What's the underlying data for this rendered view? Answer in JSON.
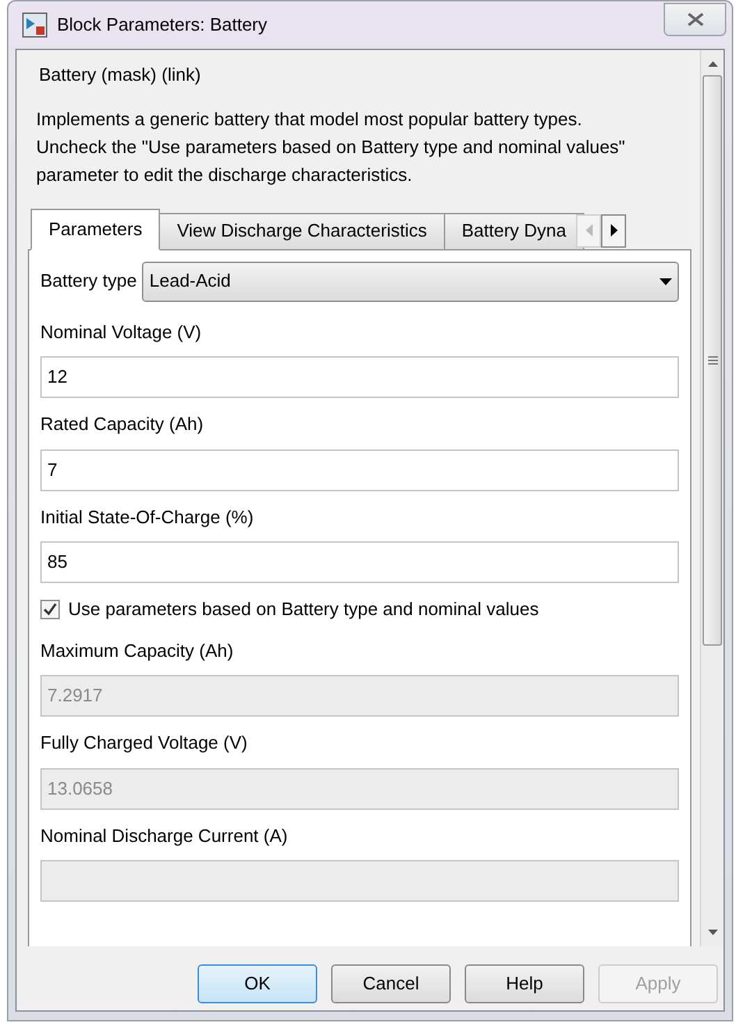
{
  "window": {
    "title": "Block Parameters: Battery"
  },
  "header": "Battery (mask) (link)",
  "description": "Implements a generic battery that model most popular battery types. Uncheck the \"Use parameters based on Battery type and nominal values\" parameter to edit the discharge characteristics.",
  "tabs": [
    {
      "label": "Parameters",
      "selected": true
    },
    {
      "label": "View Discharge Characteristics",
      "selected": false
    },
    {
      "label": "Battery Dyna",
      "selected": false
    }
  ],
  "parameters": [
    {
      "kind": "dropdown",
      "label": "Battery type",
      "value": "Lead-Acid"
    },
    {
      "kind": "text",
      "label": "Nominal Voltage (V)",
      "value": "12",
      "disabled": false
    },
    {
      "kind": "text",
      "label": "Rated Capacity (Ah)",
      "value": "7",
      "disabled": false
    },
    {
      "kind": "text",
      "label": "Initial State-Of-Charge (%)",
      "value": "85",
      "disabled": false
    },
    {
      "kind": "checkbox",
      "label": "Use parameters based on Battery type and nominal values",
      "checked": true
    },
    {
      "kind": "text",
      "label": "Maximum Capacity (Ah)",
      "value": "7.2917",
      "disabled": true
    },
    {
      "kind": "text",
      "label": "Fully Charged Voltage (V)",
      "value": "13.0658",
      "disabled": true
    },
    {
      "kind": "text",
      "label": "Nominal Discharge Current (A)",
      "disabled": true
    }
  ],
  "buttons": [
    {
      "label": "OK",
      "disabled": false,
      "default": true
    },
    {
      "label": "Cancel",
      "disabled": false,
      "default": false
    },
    {
      "label": "Help",
      "disabled": false,
      "default": false
    },
    {
      "label": "Apply",
      "disabled": true,
      "default": false
    }
  ]
}
